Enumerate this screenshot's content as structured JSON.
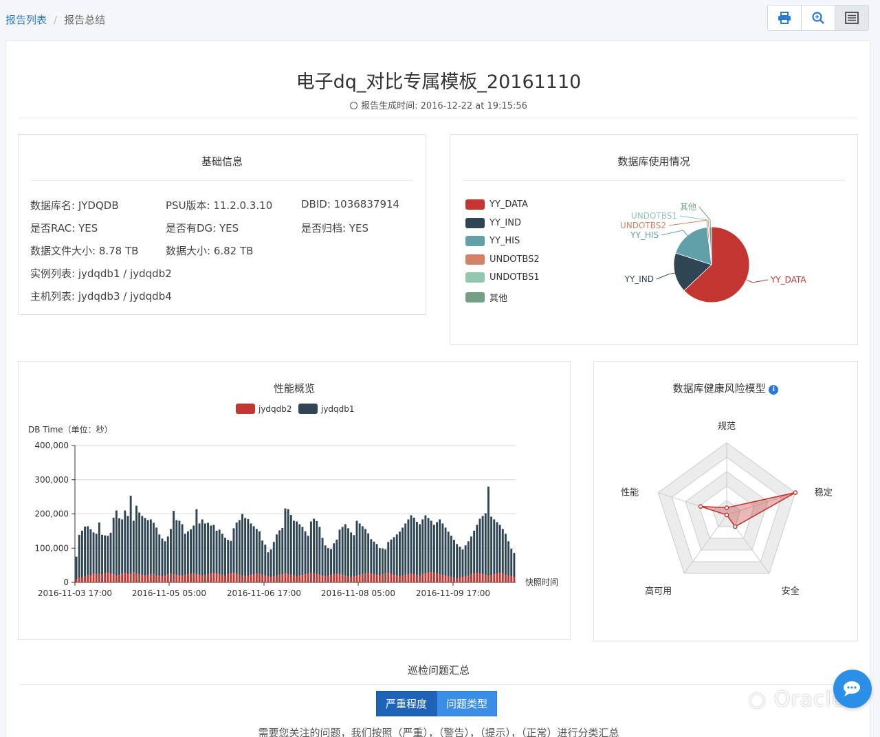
{
  "breadcrumb": {
    "parent": "报告列表",
    "separator": "/",
    "current": "报告总结"
  },
  "toolbar": {
    "icons": [
      "print-icon",
      "search-zoom-icon",
      "list-view-icon"
    ]
  },
  "report": {
    "title": "电子dq_对比专属模板_20161110",
    "generated": "报告生成时间: 2016-12-22 at 19:15:56"
  },
  "basic_info": {
    "title": "基础信息",
    "rows": [
      [
        "数据库名: JYDQDB",
        "PSU版本: 11.2.0.3.10",
        "DBID: 1036837914"
      ],
      [
        "是否RAC: YES",
        "是否有DG: YES",
        "是否归档: YES"
      ],
      [
        "数据文件大小: 8.78 TB",
        "数据大小: 6.82 TB"
      ],
      [
        "实例列表: jydqdb1 / jydqdb2"
      ],
      [
        "主机列表: jydqdb3 / jydqdb4"
      ]
    ]
  },
  "db_usage": {
    "title": "数据库使用情况",
    "legend": [
      "YY_DATA",
      "YY_IND",
      "YY_HIS",
      "UNDOTBS2",
      "UNDOTBS1",
      "其他"
    ],
    "colors": [
      "#c23531",
      "#2f4554",
      "#61a0a8",
      "#d48265",
      "#91c7ae",
      "#749f83"
    ]
  },
  "perf": {
    "title": "性能概览",
    "legend": [
      "jydqdb2",
      "jydqdb1"
    ],
    "ylabel": "DB Time（单位：秒）",
    "xlabel": "快照时间"
  },
  "health": {
    "title": "数据库健康风险模型",
    "info_icon": "info-icon",
    "axes": [
      "规范",
      "稳定",
      "安全",
      "高可用",
      "性能"
    ]
  },
  "issues": {
    "title": "巡检问题汇总",
    "tabs": [
      "严重程度",
      "问题类型"
    ],
    "description": "需要您关注的问题，我们按照（严重），（警告），（提示），（正常）进行分类汇总"
  },
  "watermark": "Oracle",
  "chart_data": [
    {
      "type": "pie",
      "title": "数据库使用情况",
      "categories": [
        "YY_DATA",
        "YY_IND",
        "YY_HIS",
        "UNDOTBS2",
        "UNDOTBS1",
        "其他"
      ],
      "values": [
        63,
        17,
        18,
        0.6,
        0.4,
        1
      ],
      "colors": [
        "#c23531",
        "#2f4554",
        "#61a0a8",
        "#d48265",
        "#91c7ae",
        "#749f83"
      ],
      "legend": "left"
    },
    {
      "type": "bar",
      "title": "性能概览",
      "ylabel": "DB Time（单位：秒）",
      "xlabel": "快照时间",
      "ylim": [
        0,
        400000
      ],
      "yticks": [
        "0",
        "100,000",
        "200,000",
        "300,000",
        "400,000"
      ],
      "xticks": [
        "2016-11-03 17:00",
        "2016-11-05 05:00",
        "2016-11-06 17:00",
        "2016-11-08 05:00",
        "2016-11-09 17:00"
      ],
      "stacked": true,
      "grid": true,
      "legend": "top",
      "series": [
        {
          "name": "jydqdb2",
          "color": "#c23531",
          "values": [
            10000,
            14000,
            16000,
            18000,
            22000,
            20000,
            26000,
            24000,
            25000,
            24000,
            27000,
            28000,
            25000,
            24000,
            20000,
            22000,
            26000,
            28000,
            24000,
            25000,
            30000,
            26000,
            24000,
            22000,
            20000,
            22000,
            24000,
            24000,
            20000,
            20000,
            18000,
            20000,
            24000,
            26000,
            24000,
            22000,
            20000,
            20000,
            22000,
            24000,
            25000,
            26000,
            24000,
            22000,
            20000,
            22000,
            24000,
            26000,
            28000,
            26000,
            24000,
            22000,
            20000,
            24000,
            26000,
            28000,
            25000,
            22000,
            20000,
            18000,
            20000,
            22000,
            24000,
            26000,
            24000,
            22000,
            20000,
            18000,
            16000,
            18000,
            20000,
            22000,
            24000,
            26000,
            24000,
            22000,
            20000,
            18000,
            20000,
            22000,
            24000,
            26000,
            28000,
            26000,
            24000,
            22000,
            20000,
            18000,
            20000,
            22000,
            24000,
            25000,
            24000,
            22000,
            20000,
            18000,
            16000,
            18000,
            20000,
            22000,
            24000,
            26000,
            28000,
            26000,
            24000,
            22000,
            20000,
            24000,
            26000,
            28000,
            25000,
            22000,
            20000,
            18000,
            20000,
            22000,
            24000,
            26000,
            24000,
            22000,
            20000,
            24000,
            26000,
            28000,
            30000,
            28000,
            26000,
            24000,
            22000,
            20000,
            18000,
            16000,
            14000,
            12000,
            14000,
            16000,
            18000,
            20000,
            24000,
            26000,
            28000,
            26000,
            24000,
            22000,
            20000,
            22000,
            24000,
            26000,
            28000,
            26000,
            22000,
            20000,
            18000,
            16000
          ]
        },
        {
          "name": "jydqdb1",
          "color": "#2f4554",
          "values": [
            65000,
            125000,
            135000,
            145000,
            142000,
            135000,
            120000,
            118000,
            150000,
            115000,
            110000,
            108000,
            120000,
            165000,
            190000,
            165000,
            158000,
            182000,
            170000,
            228000,
            150000,
            198000,
            180000,
            172000,
            168000,
            160000,
            160000,
            150000,
            140000,
            120000,
            110000,
            100000,
            110000,
            130000,
            185000,
            160000,
            160000,
            150000,
            120000,
            125000,
            130000,
            140000,
            190000,
            150000,
            164000,
            150000,
            150000,
            140000,
            140000,
            125000,
            130000,
            120000,
            110000,
            100000,
            95000,
            130000,
            150000,
            160000,
            180000,
            170000,
            165000,
            150000,
            140000,
            130000,
            125000,
            100000,
            90000,
            70000,
            80000,
            100000,
            120000,
            130000,
            135000,
            190000,
            190000,
            175000,
            160000,
            160000,
            150000,
            140000,
            125000,
            110000,
            150000,
            160000,
            155000,
            140000,
            110000,
            90000,
            80000,
            75000,
            90000,
            100000,
            130000,
            140000,
            150000,
            140000,
            130000,
            120000,
            160000,
            150000,
            140000,
            130000,
            115000,
            100000,
            95000,
            90000,
            80000,
            75000,
            70000,
            90000,
            100000,
            110000,
            120000,
            130000,
            140000,
            150000,
            160000,
            170000,
            165000,
            155000,
            150000,
            160000,
            170000,
            160000,
            150000,
            140000,
            150000,
            160000,
            150000,
            140000,
            130000,
            120000,
            110000,
            100000,
            90000,
            80000,
            90000,
            100000,
            110000,
            125000,
            140000,
            160000,
            170000,
            180000,
            260000,
            170000,
            160000,
            150000,
            140000,
            130000,
            120000,
            100000,
            80000,
            70000
          ]
        }
      ]
    },
    {
      "type": "radar",
      "title": "数据库健康风险模型",
      "categories": [
        "规范",
        "稳定",
        "安全",
        "高可用",
        "性能"
      ],
      "max": 100,
      "values": [
        10,
        100,
        20,
        0,
        38
      ],
      "color": "#c23531"
    }
  ]
}
